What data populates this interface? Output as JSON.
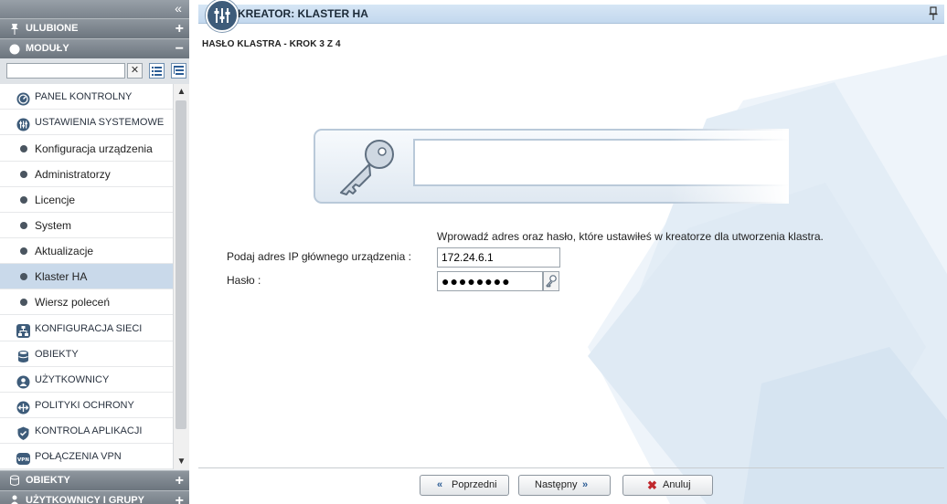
{
  "sidebar": {
    "collapse_glyph": "«",
    "sections": {
      "favorites": {
        "label": "ULUBIONE",
        "action": "+",
        "icon": "pin-icon"
      },
      "modules": {
        "label": "MODUŁY",
        "action": "−",
        "icon": "modules-icon"
      },
      "objects": {
        "label": "OBIEKTY",
        "action": "+",
        "icon": "database-icon"
      },
      "users_groups": {
        "label": "UŻYTKOWNICY I GRUPY",
        "action": "+",
        "icon": "user-icon"
      }
    },
    "filter": {
      "value": "",
      "placeholder": "",
      "clear_glyph": "✕"
    },
    "tree": {
      "control_panel": "PANEL KONTROLNY",
      "system_settings": "USTAWIENIA SYSTEMOWE",
      "sub_items": [
        "Konfiguracja urządzenia",
        "Administratorzy",
        "Licencje",
        "System",
        "Aktualizacje",
        "Klaster HA",
        "Wiersz poleceń"
      ],
      "selected_sub_item": "Klaster HA",
      "network_config": "KONFIGURACJA SIECI",
      "objects": "OBIEKTY",
      "users": "UŻYTKOWNICY",
      "security_policies": "POLITYKI OCHRONY",
      "app_control": "KONTROLA APLIKACJI",
      "vpn": "POŁĄCZENIA VPN"
    }
  },
  "wizard": {
    "title": "KREATOR: KLASTER HA",
    "step_heading": "HASŁO KLASTRA - KROK 3 Z 4",
    "instruction": "Wprowadź adres oraz hasło, które ustawiłeś w kreatorze dla utworzenia klastra.",
    "ip_label": "Podaj adres IP głównego urządzenia :",
    "ip_value": "172.24.6.1",
    "password_label": "Hasło :",
    "password_value": "●●●●●●●●",
    "buttons": {
      "previous": "Poprzedni",
      "next": "Następny",
      "cancel": "Anuluj"
    },
    "colors": {
      "accent": "#3e5c7a",
      "cancel_icon": "#c0282d",
      "nav_arrow": "#2c5d95"
    }
  }
}
